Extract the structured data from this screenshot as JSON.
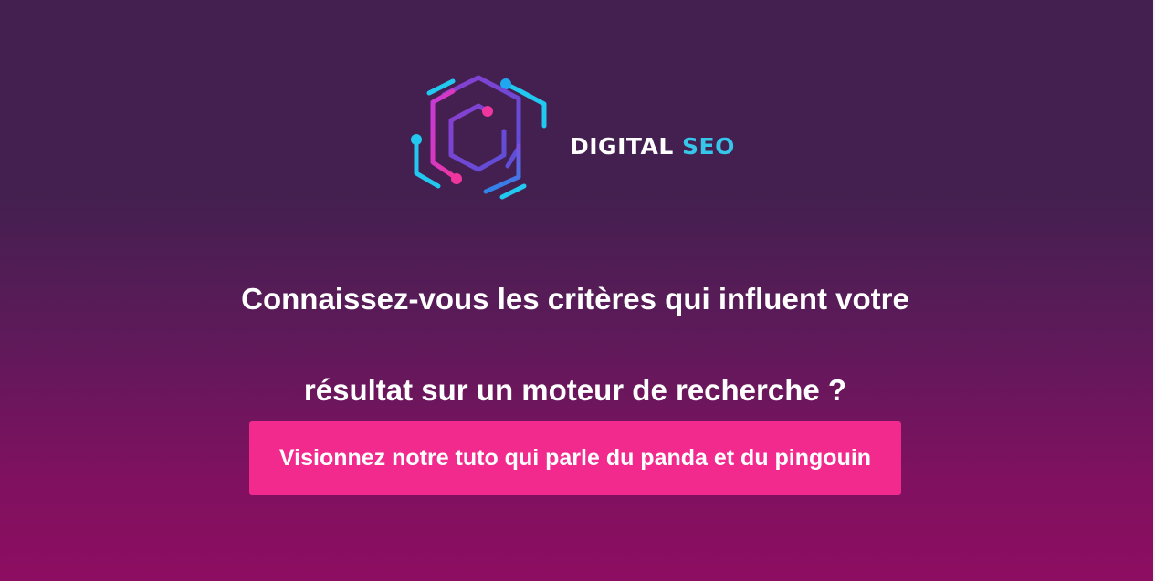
{
  "brand": {
    "name_part1": "DIGITAL",
    "name_part2": "SEO",
    "logo_icon": "hexagon-circuit-icon",
    "colors": {
      "magenta": "#f0369e",
      "violet": "#8a3fd0",
      "cyan": "#22c8ef",
      "blue": "#2e86e8"
    }
  },
  "headline": {
    "line1": "Connaissez-vous les critères qui influent votre",
    "line2": "résultat sur un moteur de recherche ?"
  },
  "cta": {
    "label": "Visionnez notre tuto qui parle du panda et du pingouin",
    "color": "#f22a8e"
  },
  "colors": {
    "background_top": "#432050",
    "background_bottom": "#8d0d61",
    "text": "#ffffff"
  }
}
